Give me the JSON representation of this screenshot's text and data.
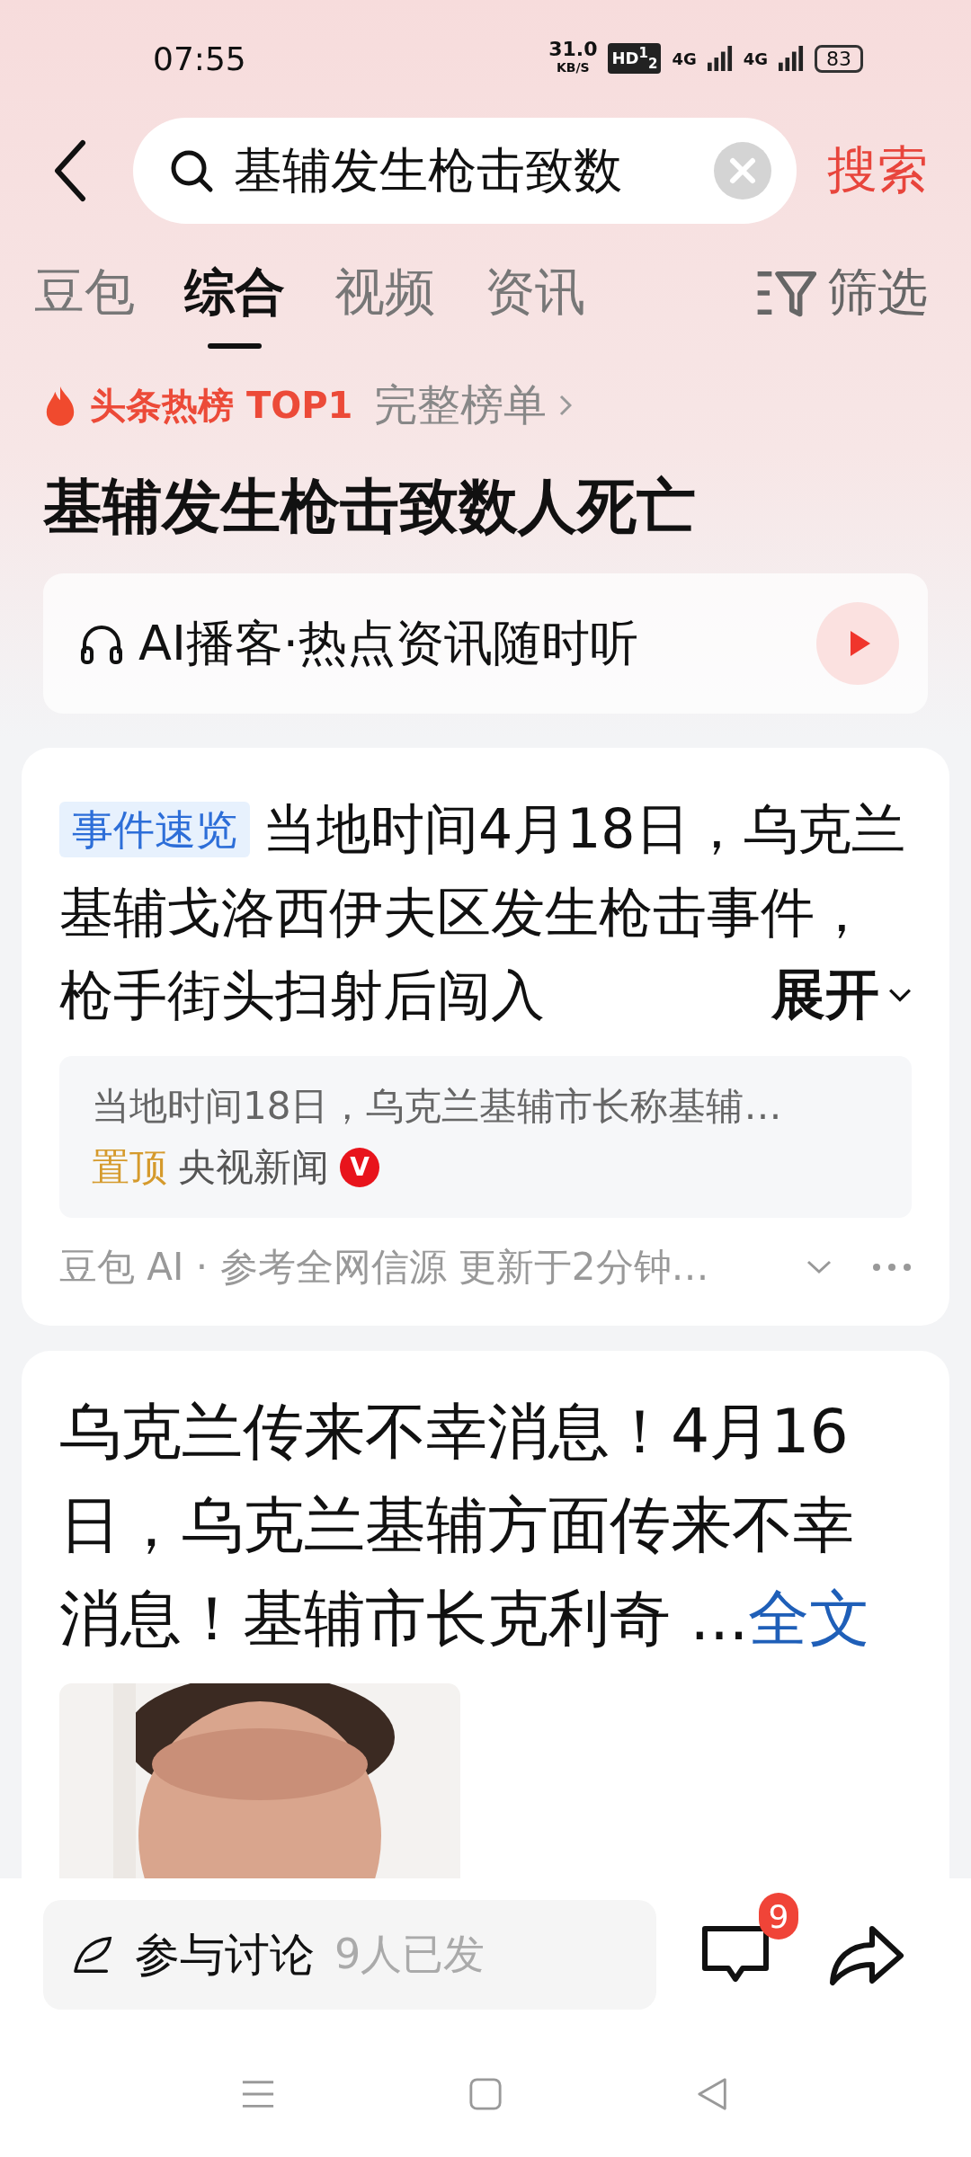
{
  "status_bar": {
    "time": "07:55",
    "net_speed": "31.0",
    "net_unit": "KB/S",
    "hd_badge": "HD$^{1}$$_{2}$",
    "network_1": "4G",
    "network_2": "4G",
    "battery": "83"
  },
  "search": {
    "value": "基辅发生枪击致数",
    "submit": "搜索"
  },
  "tabs": [
    {
      "label": "豆包",
      "selected": false
    },
    {
      "label": "综合",
      "selected": true
    },
    {
      "label": "视频",
      "selected": false
    },
    {
      "label": "资讯",
      "selected": false
    }
  ],
  "filter": "筛选",
  "hot": {
    "label": "头条热榜 TOP1",
    "link": "完整榜单"
  },
  "title": "基辅发生枪击致数人死亡",
  "podcast": {
    "label": "AI播客·热点资讯随时听"
  },
  "summary_card": {
    "tag": "事件速览",
    "text": "当地时间4月18日，乌克兰基辅戈洛西伊夫区发生枪击事件，枪手街头扫射后闯入",
    "expand": "展开",
    "quote": {
      "text": "当地时间18日，乌克兰基辅市长称基辅…",
      "pinned": "置顶",
      "source": "央视新闻",
      "verified": "V"
    },
    "footer": "豆包 AI · 参考全网信源 更新于2分钟…"
  },
  "article": {
    "text": "乌克兰传来不幸消息！4月16日，乌克兰基辅方面传来不幸消息！基辅市长克利奇 ...",
    "more": "全文"
  },
  "discussion": {
    "label": "参与讨论",
    "count": "9人已发"
  },
  "comments_badge": "9"
}
